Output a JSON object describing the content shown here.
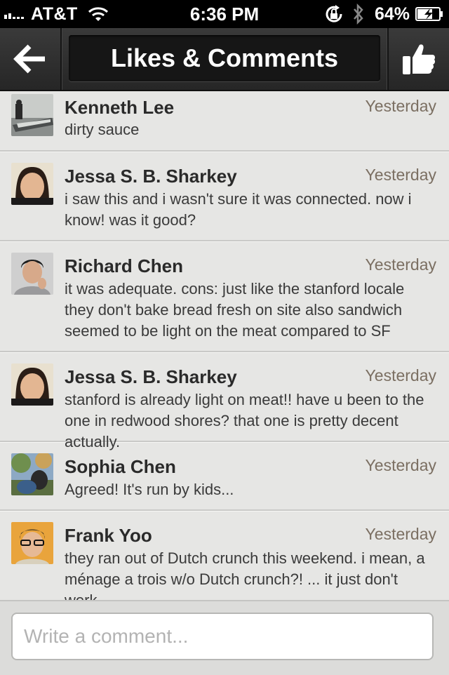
{
  "status_bar": {
    "carrier": "AT&T",
    "time": "6:36 PM",
    "battery": "64%"
  },
  "nav": {
    "title": "Likes & Comments",
    "back_icon": "back-arrow-icon",
    "like_icon": "thumbs-up-icon"
  },
  "comments": [
    {
      "author": "Kenneth Lee",
      "time": "Yesterday",
      "text": "dirty sauce"
    },
    {
      "author": "Jessa S. B. Sharkey",
      "time": "Yesterday",
      "text": "i saw this and i wasn't sure it was connected. now i know! was it good?"
    },
    {
      "author": "Richard Chen",
      "time": "Yesterday",
      "text": "it was adequate. cons: just like the stanford locale they don't bake bread fresh on site also sandwich seemed to be light on the meat compared to SF"
    },
    {
      "author": "Jessa S. B. Sharkey",
      "time": "Yesterday",
      "text": "stanford is already light on meat!! have u been to the one in redwood shores? that one is pretty decent actually."
    },
    {
      "author": "Sophia Chen",
      "time": "Yesterday",
      "text": "Agreed! It's run by kids..."
    },
    {
      "author": "Frank Yoo",
      "time": "Yesterday",
      "text": "they ran out of Dutch crunch this weekend. i mean, a ménage a trois w/o Dutch crunch?! ... it just don't werk."
    }
  ],
  "composer": {
    "placeholder": "Write a comment..."
  },
  "colors": {
    "background": "#e6e6e4",
    "navbar": "#2e2e2e",
    "timestamp": "#7b6f62"
  }
}
